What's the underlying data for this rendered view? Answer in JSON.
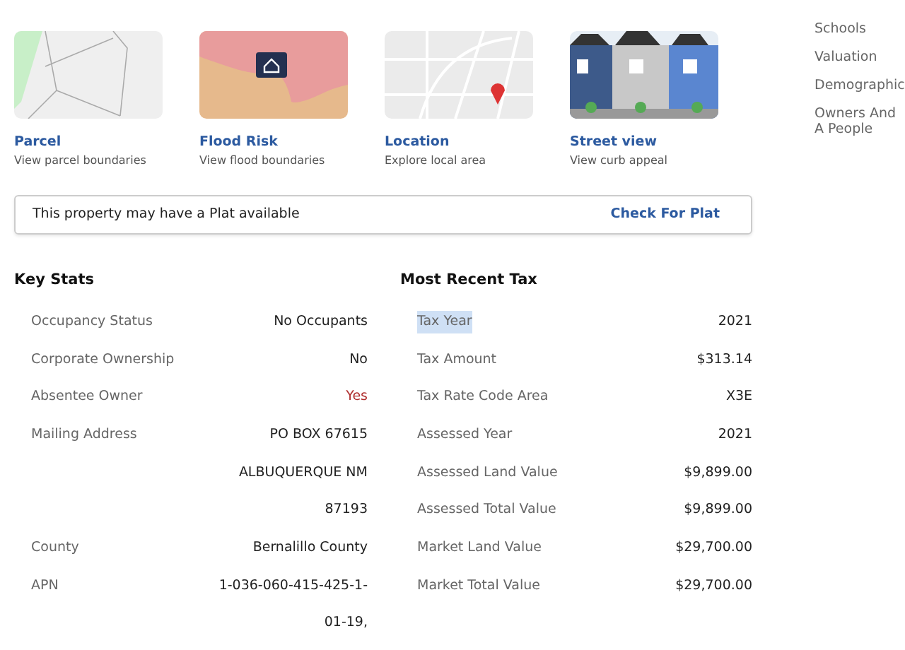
{
  "cards": [
    {
      "kind": "parcel",
      "title": "Parcel",
      "subtitle": "View parcel boundaries"
    },
    {
      "kind": "flood",
      "title": "Flood Risk",
      "subtitle": "View flood boundaries"
    },
    {
      "kind": "location",
      "title": "Location",
      "subtitle": "Explore local area"
    },
    {
      "kind": "street",
      "title": "Street view",
      "subtitle": "View curb appeal"
    }
  ],
  "plat": {
    "message": "This property may have a Plat available",
    "link": "Check For Plat"
  },
  "key_stats": {
    "title": "Key Stats",
    "rows": [
      {
        "label": "Occupancy Status",
        "value": [
          "No Occupants"
        ],
        "warning": false
      },
      {
        "label": "Corporate Ownership",
        "value": [
          "No"
        ],
        "warning": false
      },
      {
        "label": "Absentee Owner",
        "value": [
          "Yes"
        ],
        "warning": true
      },
      {
        "label": "Mailing Address",
        "value": [
          "PO BOX 67615",
          "ALBUQUERQUE NM",
          "87193"
        ],
        "warning": false
      },
      {
        "label": "County",
        "value": [
          "Bernalillo County"
        ],
        "warning": false
      },
      {
        "label": "APN",
        "value": [
          "1-036-060-415-425-1-",
          "01-19,"
        ],
        "warning": false
      }
    ]
  },
  "tax": {
    "title": "Most Recent Tax",
    "rows": [
      {
        "label": "Tax Year",
        "value": "2021",
        "highlighted": true
      },
      {
        "label": "Tax Amount",
        "value": "$313.14",
        "highlighted": false
      },
      {
        "label": "Tax Rate Code Area",
        "value": "X3E",
        "highlighted": false
      },
      {
        "label": "Assessed Year",
        "value": "2021",
        "highlighted": false
      },
      {
        "label": "Assessed Land Value",
        "value": "$9,899.00",
        "highlighted": false
      },
      {
        "label": "Assessed Total Value",
        "value": "$9,899.00",
        "highlighted": false
      },
      {
        "label": "Market Land Value",
        "value": "$29,700.00",
        "highlighted": false
      },
      {
        "label": "Market Total Value",
        "value": "$29,700.00",
        "highlighted": false
      }
    ]
  },
  "sidebar": {
    "items": [
      "Schools",
      "Valuation",
      "Demographic",
      "Owners And A People"
    ]
  }
}
